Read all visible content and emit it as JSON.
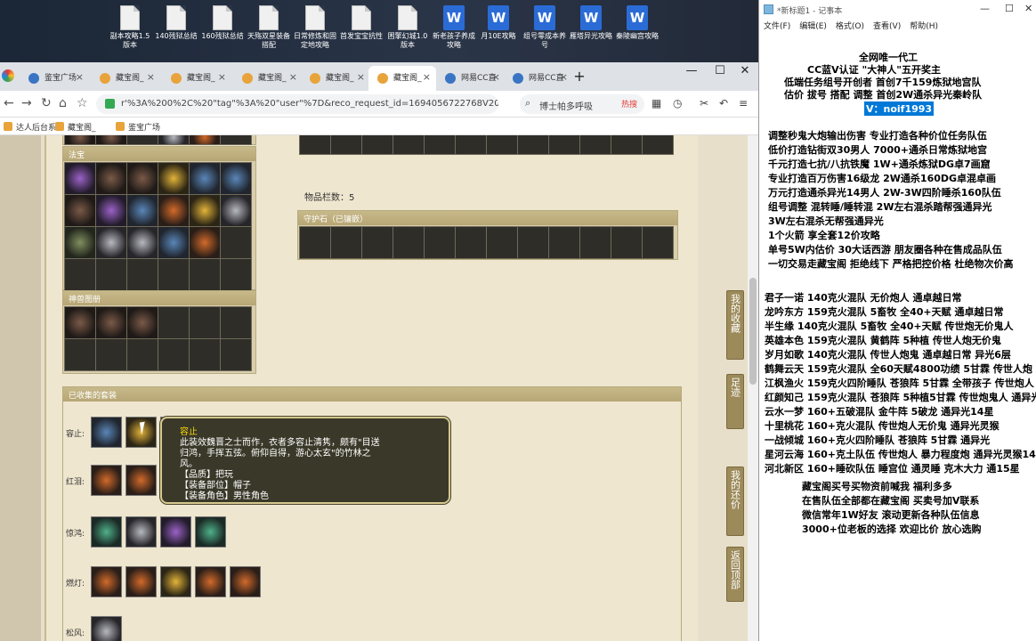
{
  "desktop": {
    "icons": [
      {
        "label": "副本攻略1.5版本",
        "type": "file"
      },
      {
        "label": "140残狱总结",
        "type": "file"
      },
      {
        "label": "160残狱总结",
        "type": "file"
      },
      {
        "label": "天殇双星装备搭配",
        "type": "file"
      },
      {
        "label": "日常修炼和固定地攻略",
        "type": "file"
      },
      {
        "label": "首发宝宝抗性",
        "type": "file"
      },
      {
        "label": "困擎幻城1.0版本",
        "type": "file"
      },
      {
        "label": "新老孩子养成攻略",
        "type": "word"
      },
      {
        "label": "月10E攻略",
        "type": "word"
      },
      {
        "label": "组号零成本养号",
        "type": "word"
      },
      {
        "label": "雁塔异光攻略",
        "type": "word"
      },
      {
        "label": "秦陵幽宫攻略",
        "type": "word"
      }
    ]
  },
  "browser": {
    "tabs": [
      {
        "label": "鉴宝广场",
        "icon": "globe"
      },
      {
        "label": "藏宝阁_",
        "icon": "treasure"
      },
      {
        "label": "藏宝阁_",
        "icon": "treasure"
      },
      {
        "label": "藏宝阁_",
        "icon": "treasure"
      },
      {
        "label": "藏宝阁_",
        "icon": "treasure"
      },
      {
        "label": "藏宝阁_",
        "icon": "treasure"
      },
      {
        "label": "网易CC直",
        "icon": "globe"
      },
      {
        "label": "网易CC直",
        "icon": "globe"
      }
    ],
    "active_tab_index": 5,
    "url": "r'%3A%200%2C%20\"tag\"%3A%20\"user\"%7D&reco_request_id=1694056722768V20m6",
    "search_placeholder": "博士帕多呼吸",
    "search_hot": "热搜",
    "bookmarks": [
      "达人后台系",
      "藏宝阁_",
      "鉴宝广场"
    ],
    "nav_icons": [
      "back-icon",
      "forward-icon",
      "reload-icon",
      "home-icon",
      "star-icon"
    ]
  },
  "game": {
    "fabao_title": "法宝",
    "tuzhi_title": "神兽图册",
    "item_count_label": "物品栏数：5",
    "shouhu_title": "守护石（已镶嵌）",
    "suits_title": "已收集的套装",
    "suit_rows": [
      {
        "label": "容止:",
        "count": 3
      },
      {
        "label": "红泪:",
        "count": 3
      },
      {
        "label": "惊鸿:",
        "count": 4
      },
      {
        "label": "燃灯:",
        "count": 5
      },
      {
        "label": "松风:",
        "count": 1
      }
    ],
    "tooltip": {
      "name": "容止",
      "desc1": "此装效魏晋之士而作，衣者多容止清隽，颇有\"目送",
      "desc2": "归鸿，手挥五弦。俯仰自得，游心太玄\"的竹林之",
      "desc3": "风。",
      "quality": "【品质】把玩",
      "slot": "【装备部位】帽子",
      "role": "【装备角色】男性角色"
    },
    "side_nav": [
      "我的收藏",
      "足迹",
      "我的还价",
      "返回顶部"
    ]
  },
  "notepad": {
    "title": "*新标题1 - 记事本",
    "menu": [
      "文件(F)",
      "编辑(E)",
      "格式(O)",
      "查看(V)",
      "帮助(H)"
    ],
    "lines": [
      "全网唯一代工",
      "CC蓝V认证 \"大神人\"五开奖主",
      "低端任务组号开创者        首创7千159炼狱地宫队",
      "估价 拔号 搭配 调整        首创2W通杀异光秦岭队",
      "V：noif1993",
      "调整秒鬼大炮输出伤害          专业打造各种价位任务队伍",
      "低价打造钻街双30男人          7000+通杀日常炼狱地宫",
      "千元打造七抗/八抗铁魔          1W+通杀炼狱DG卓7画窟",
      "专业打造百万伤害16级龙         2W通杀160DG卓混卓画",
      "万元打造通杀异光14男人       2W-3W四阶睡杀160队伍",
      "组号调整 混转睡/睡转混          2W左右混杀踏帮强通异光",
      "                              3W左右混杀无帮强通异光",
      "1个火箭 享全套12价攻略",
      "单号5W内估价 30大话西游          朋友圈各种在售成品队伍",
      "一切交易走藏宝阁 拒绝线下     严格把控价格 杜绝物次价高",
      "君子一诺 140克火混队 无价炮人 通卓越日常",
      "龙吟东方 159克火混队 5畜牧 全40+天赋 通卓越日常",
      "半生缘    140克火混队 5畜牧 全40+天赋 传世炮无价鬼人",
      "英雄本色 159克火混队 黄鹤阵 5种植 传世人炮无价鬼",
      "岁月如歌 140克火混队 传世人炮鬼 通卓越日常 异光6层",
      "鹤舞云天 159克火混队 全60天赋4800功绩 5甘霖 传世人炮",
      "江枫渔火 159克火四阶睡队 苍狼阵 5甘霖 全带孩子 传世炮人",
      "红颜知己 159克火混队 苍狼阵 5种植5甘霖 传世炮鬼人 通异光",
      "云水一梦 160+五破混队 金牛阵 5破龙 通异光14星",
      "十里桃花 160+克火混队 传世炮人无价鬼 通异光灵猴",
      "一战倾城 160+克火四阶睡队 苍狼阵 5甘霖 通异光",
      "星河云海 160+克土队伍 传世炮人 暴力程度炮 通异光灵猴14",
      "河北新区 160+睡砍队伍 睡宫位 通灵睡 克木大力 通15星",
      "藏宝阁买号买物资前喊我 福利多多",
      "在售队伍全部都在藏宝阁 买卖号加V联系",
      "微信常年1W好友 滚动更新各种队伍信息",
      "3000+位老板的选择 欢迎比价 放心选购"
    ]
  }
}
